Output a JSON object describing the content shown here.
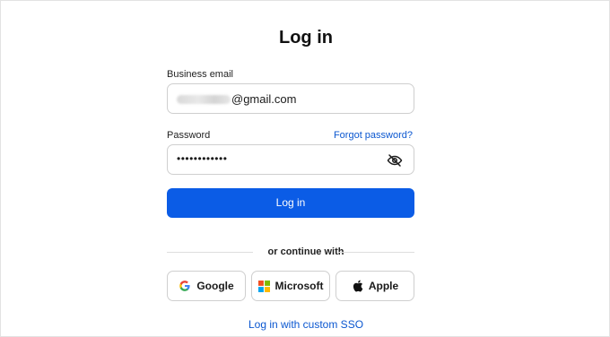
{
  "page": {
    "title": "Log in"
  },
  "email": {
    "label": "Business email",
    "value": "@gmail.com"
  },
  "password": {
    "label": "Password",
    "forgot_link": "Forgot password?",
    "value": "••••••••••••",
    "visibility_icon": "eye-off-icon"
  },
  "login_button": {
    "label": "Log in",
    "color": "#0b5ce6"
  },
  "divider": {
    "text": "or continue with"
  },
  "providers": [
    {
      "label": "Google",
      "icon": "google-icon"
    },
    {
      "label": "Microsoft",
      "icon": "microsoft-icon"
    },
    {
      "label": "Apple",
      "icon": "apple-icon"
    }
  ],
  "custom_sso": {
    "label": "Log in with custom SSO"
  },
  "colors": {
    "accent": "#0b5ce6",
    "link": "#0b57d0",
    "border": "#cfcfcf"
  }
}
